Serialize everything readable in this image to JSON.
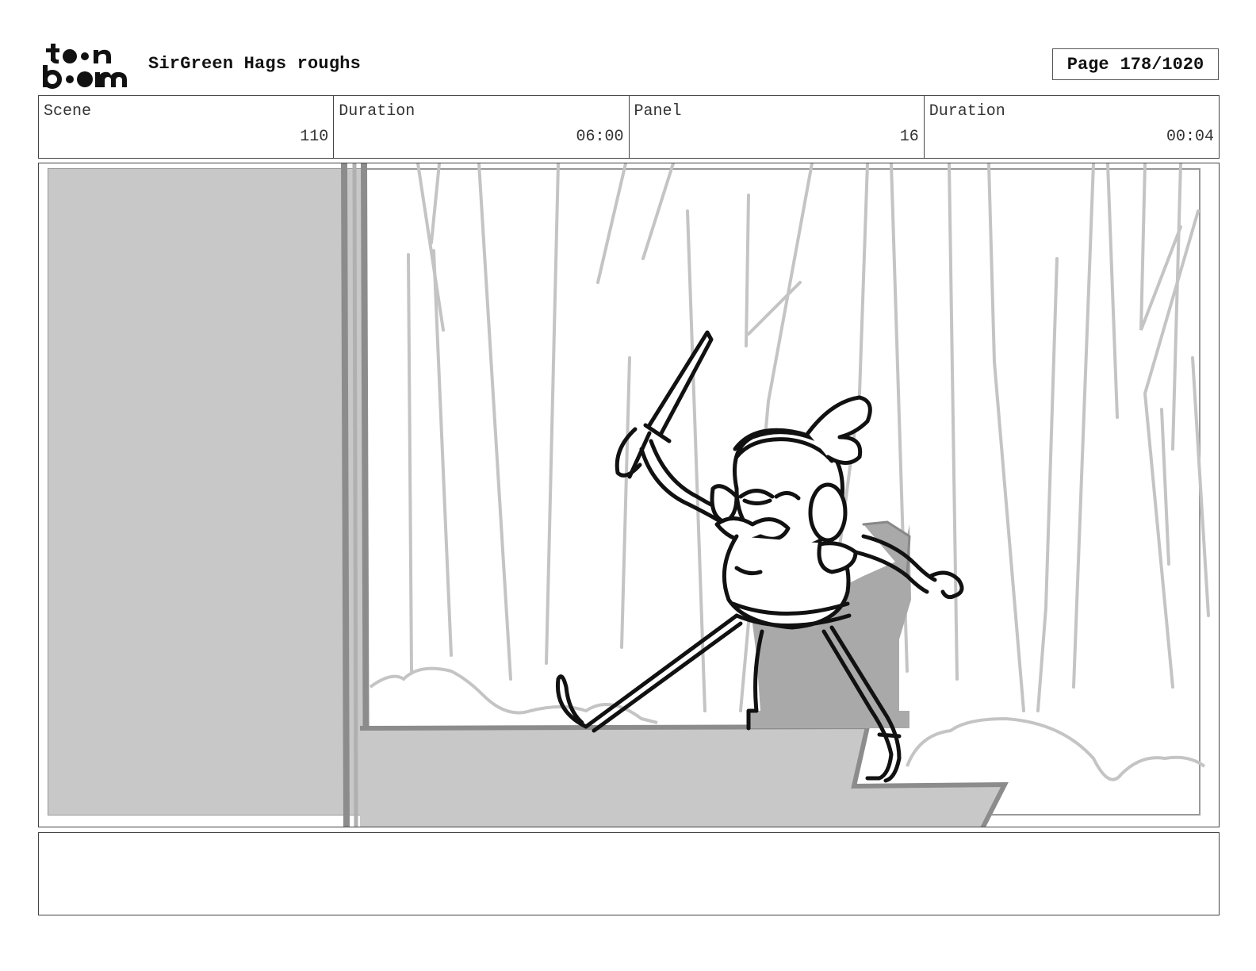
{
  "header": {
    "logo_text": "toonboom",
    "project_title": "SirGreen Hags roughs",
    "page_label": "Page",
    "page_number": "178/1020"
  },
  "info": {
    "scene_label": "Scene",
    "scene_value": "110",
    "scene_duration_label": "Duration",
    "scene_duration_value": "06:00",
    "panel_label": "Panel",
    "panel_value": "16",
    "panel_duration_label": "Duration",
    "panel_duration_value": "00:04"
  },
  "notes": {
    "text": ""
  }
}
